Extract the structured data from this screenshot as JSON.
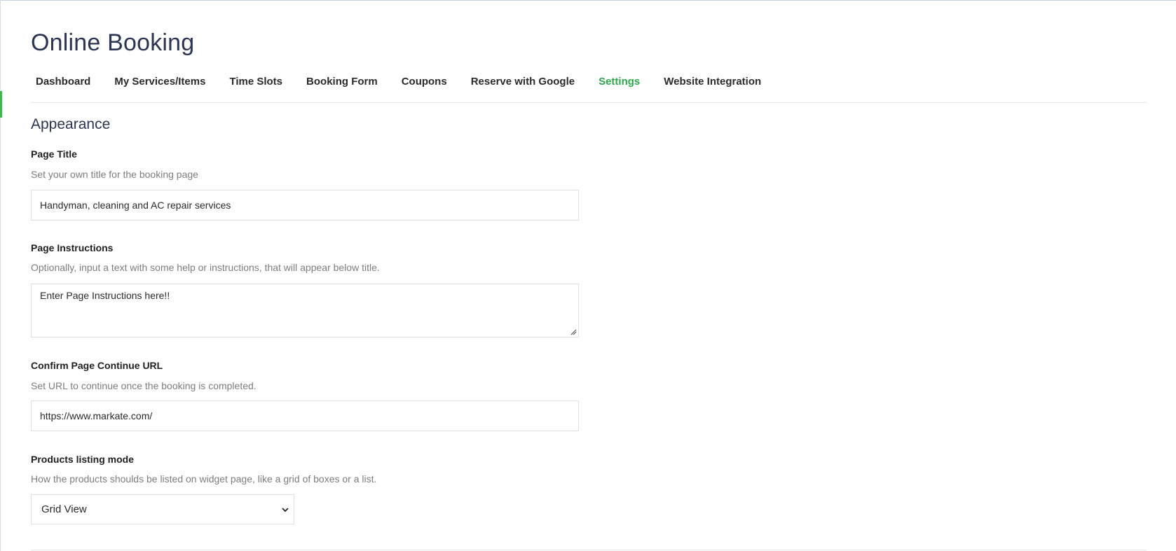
{
  "header": {
    "title": "Online Booking"
  },
  "tabs": [
    {
      "label": "Dashboard"
    },
    {
      "label": "My Services/Items"
    },
    {
      "label": "Time Slots"
    },
    {
      "label": "Booking Form"
    },
    {
      "label": "Coupons"
    },
    {
      "label": "Reserve with Google"
    },
    {
      "label": "Settings",
      "active": true
    },
    {
      "label": "Website Integration"
    }
  ],
  "section": {
    "title": "Appearance"
  },
  "fields": {
    "page_title": {
      "label": "Page Title",
      "help": "Set your own title for the booking page",
      "value": "Handyman, cleaning and AC repair services"
    },
    "page_instructions": {
      "label": "Page Instructions",
      "help": "Optionally, input a text with some help or instructions, that will appear below title.",
      "value": "Enter Page Instructions here!!"
    },
    "confirm_url": {
      "label": "Confirm Page Continue URL",
      "help": "Set URL to continue once the booking is completed.",
      "value": "https://www.markate.com/"
    },
    "listing_mode": {
      "label": "Products listing mode",
      "help": "How the products shoulds be listed on widget page, like a grid of boxes or a list.",
      "selected": "Grid View"
    }
  },
  "colors": {
    "accent": "#2aa84a",
    "heading": "#2b3554",
    "help_text": "#7d7d7d",
    "border": "#dcdfe3"
  },
  "icons": {
    "select_chevron": "chevron-down-icon",
    "resize": "resize-handle-icon"
  }
}
